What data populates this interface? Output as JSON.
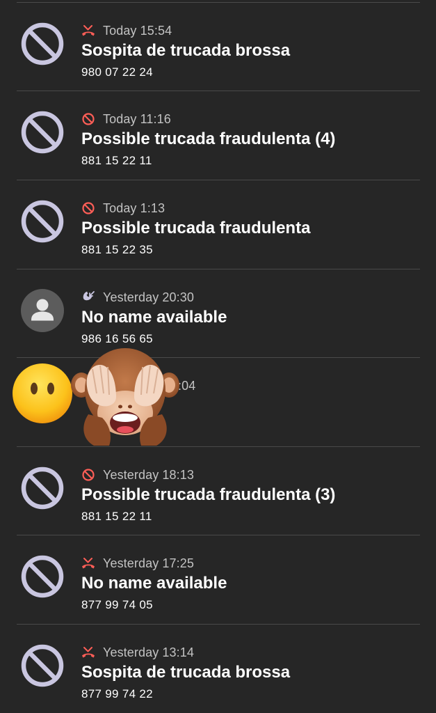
{
  "calls": [
    {
      "type": "missed",
      "icon": "missed-call-icon",
      "avatar": "blocked-icon",
      "time": "Today 15:54",
      "name": "Sospita de trucada brossa",
      "number": "980 07 22 24"
    },
    {
      "type": "blocked",
      "icon": "blocked-call-icon",
      "avatar": "blocked-icon",
      "time": "Today 11:16",
      "name": "Possible trucada fraudulenta (4)",
      "number": "881 15 22 11"
    },
    {
      "type": "blocked",
      "icon": "blocked-call-icon",
      "avatar": "blocked-icon",
      "time": "Today 1:13",
      "name": "Possible trucada fraudulenta",
      "number": "881 15 22 35"
    },
    {
      "type": "incoming",
      "icon": "incoming-call-icon",
      "avatar": "person-icon",
      "time": "Yesterday 20:30",
      "name": "No name available",
      "number": "986 16 56 65"
    },
    {
      "type": "obscured",
      "icon": "",
      "avatar": "",
      "time": ":04",
      "name": "",
      "number": ""
    },
    {
      "type": "blocked",
      "icon": "blocked-call-icon",
      "avatar": "blocked-icon",
      "time": "Yesterday 18:13",
      "name": "Possible trucada fraudulenta (3)",
      "number": "881 15 22 11"
    },
    {
      "type": "missed",
      "icon": "missed-call-icon",
      "avatar": "blocked-icon",
      "time": "Yesterday 17:25",
      "name": "No name available",
      "number": "877 99 74 05"
    },
    {
      "type": "missed",
      "icon": "missed-call-icon",
      "avatar": "blocked-icon",
      "time": "Yesterday 13:14",
      "name": "Sospita de trucada brossa",
      "number": "877 99 74 22"
    }
  ],
  "colors": {
    "background": "#262626",
    "divider": "#4a4a4a",
    "blocked_avatar": "#c9c6e0",
    "person_avatar_bg": "#5c5c5c",
    "person_avatar_fg": "#e6e6e6",
    "missed_red": "#ff5e57",
    "incoming_lavender": "#c9c6e0",
    "timestamp": "#c3c3c3"
  },
  "overlay": {
    "emojis": [
      "face-without-mouth-emoji",
      "see-no-evil-monkey-emoji"
    ]
  }
}
